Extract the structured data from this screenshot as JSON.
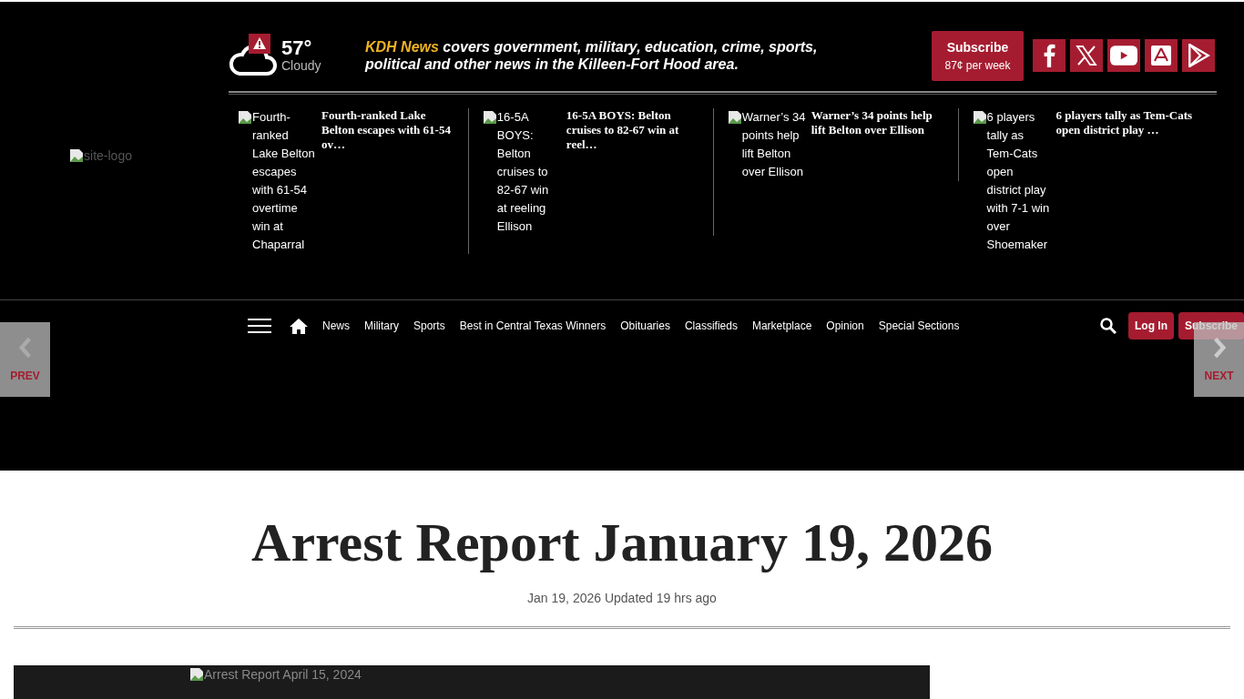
{
  "header": {
    "logo_alt": "site-logo",
    "weather": {
      "temperature": "57°",
      "condition": "Cloudy",
      "alert": true
    },
    "tagline": {
      "brand": "KDH News",
      "text": "covers government, military, education, crime, sports, political and other news in the Killeen-Fort Hood area."
    },
    "subscribe": {
      "label": "Subscribe",
      "price": "87¢ per week"
    },
    "social": [
      {
        "kind": "facebook"
      },
      {
        "kind": "x"
      },
      {
        "kind": "youtube"
      },
      {
        "kind": "appstore"
      },
      {
        "kind": "googleplay"
      }
    ]
  },
  "headlines": [
    {
      "image_alt": "Fourth-ranked Lake Belton escapes with 61-54 overtime win at Chaparral",
      "title": "Fourth-ranked Lake Belton escapes with 61-54 ov…"
    },
    {
      "image_alt": "16-5A BOYS: Belton cruises to 82-67 win at reeling Ellison",
      "title": "16-5A BOYS: Belton cruises to 82-67 win at reel…"
    },
    {
      "image_alt": "Warner’s 34 points help lift Belton over Ellison",
      "title": "Warner’s 34 points help lift Belton over Ellison"
    },
    {
      "image_alt": "6 players tally as Tem-Cats open district play with 7-1 win over Shoemaker",
      "title": "6 players tally as Tem-Cats open district play …"
    }
  ],
  "nav": {
    "items": [
      "News",
      "Military",
      "Sports",
      "Best in Central Texas Winners",
      "Obituaries",
      "Classifieds",
      "Marketplace",
      "Opinion",
      "Special Sections"
    ],
    "login": "Log In",
    "subscribe": "Subscribe"
  },
  "pager": {
    "prev": "PREV",
    "next": "NEXT"
  },
  "article": {
    "title": "Arrest Report January 19, 2026",
    "dateline": "Jan 19, 2026 Updated 19 hrs ago",
    "image_alt": "Arrest Report April 15, 2024"
  }
}
